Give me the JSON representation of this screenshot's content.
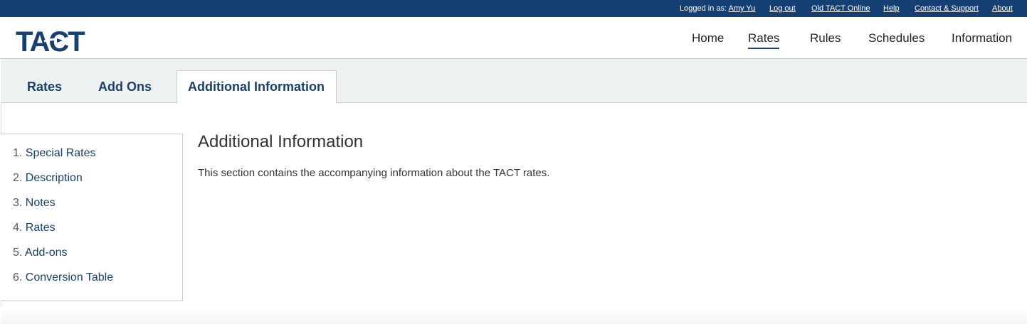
{
  "topbar": {
    "logged_in_label": "Logged in as:",
    "user_name": "Amy Yu",
    "links": [
      "Log out",
      "Old TACT Online",
      "Help",
      "Contact & Support",
      "About"
    ]
  },
  "header": {
    "logo_text": "TACT",
    "nav": [
      "Home",
      "Rates",
      "Rules",
      "Schedules",
      "Information"
    ],
    "active_nav": "Rates"
  },
  "subtabs": {
    "items": [
      "Rates",
      "Add Ons",
      "Additional Information"
    ],
    "active": "Additional Information"
  },
  "sidebar": {
    "items": [
      {
        "num": "1.",
        "label": "Special Rates"
      },
      {
        "num": "2.",
        "label": "Description"
      },
      {
        "num": "3.",
        "label": "Notes"
      },
      {
        "num": "4.",
        "label": "Rates"
      },
      {
        "num": "5.",
        "label": "Add-ons"
      },
      {
        "num": "6.",
        "label": "Conversion Table"
      }
    ]
  },
  "main": {
    "title": "Additional Information",
    "description": "This section contains the accompanying information about the TACT rates."
  },
  "colors": {
    "brand_navy": "#163f73",
    "tab_text": "#1a3f6a",
    "subtab_bg": "#eef1f2"
  }
}
